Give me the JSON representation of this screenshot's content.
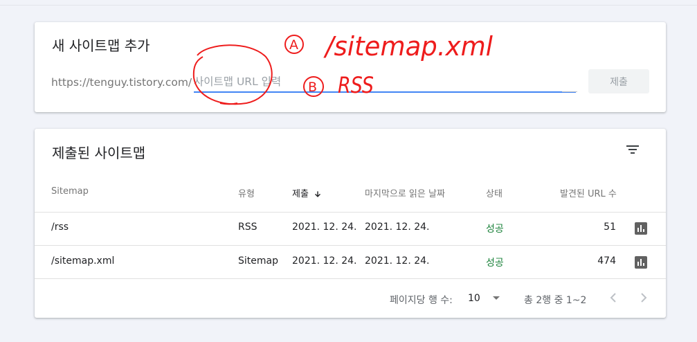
{
  "add_card": {
    "title": "새 사이트맵 추가",
    "prefix": "https://tenguy.tistory.com/",
    "input_value": "",
    "input_placeholder": "사이트맵 URL 입력",
    "submit_label": "제출"
  },
  "list_card": {
    "title": "제출된 사이트맵",
    "filter_icon": "filter-list-icon",
    "columns": [
      "Sitemap",
      "유형",
      "제출",
      "마지막으로 읽은 날짜",
      "상태",
      "발견된 URL 수"
    ],
    "sort_column": "제출",
    "rows": [
      {
        "sitemap": "/rss",
        "type": "RSS",
        "submitted": "2021. 12. 24.",
        "last_read": "2021. 12. 24.",
        "status": "성공",
        "urls": "51"
      },
      {
        "sitemap": "/sitemap.xml",
        "type": "Sitemap",
        "submitted": "2021. 12. 24.",
        "last_read": "2021. 12. 24.",
        "status": "성공",
        "urls": "474"
      }
    ],
    "pager": {
      "rows_per_page_label": "페이지당 행 수:",
      "rows_per_page": "10",
      "range": "총 2행 중 1~2"
    }
  },
  "annotations": {
    "a_mark": "A",
    "a_text": "/sitemap.xml",
    "b_mark": "B",
    "b_text": "RSS"
  },
  "colors": {
    "accent": "#4285f4",
    "success": "#188038",
    "annotation": "#ee1c1c"
  }
}
